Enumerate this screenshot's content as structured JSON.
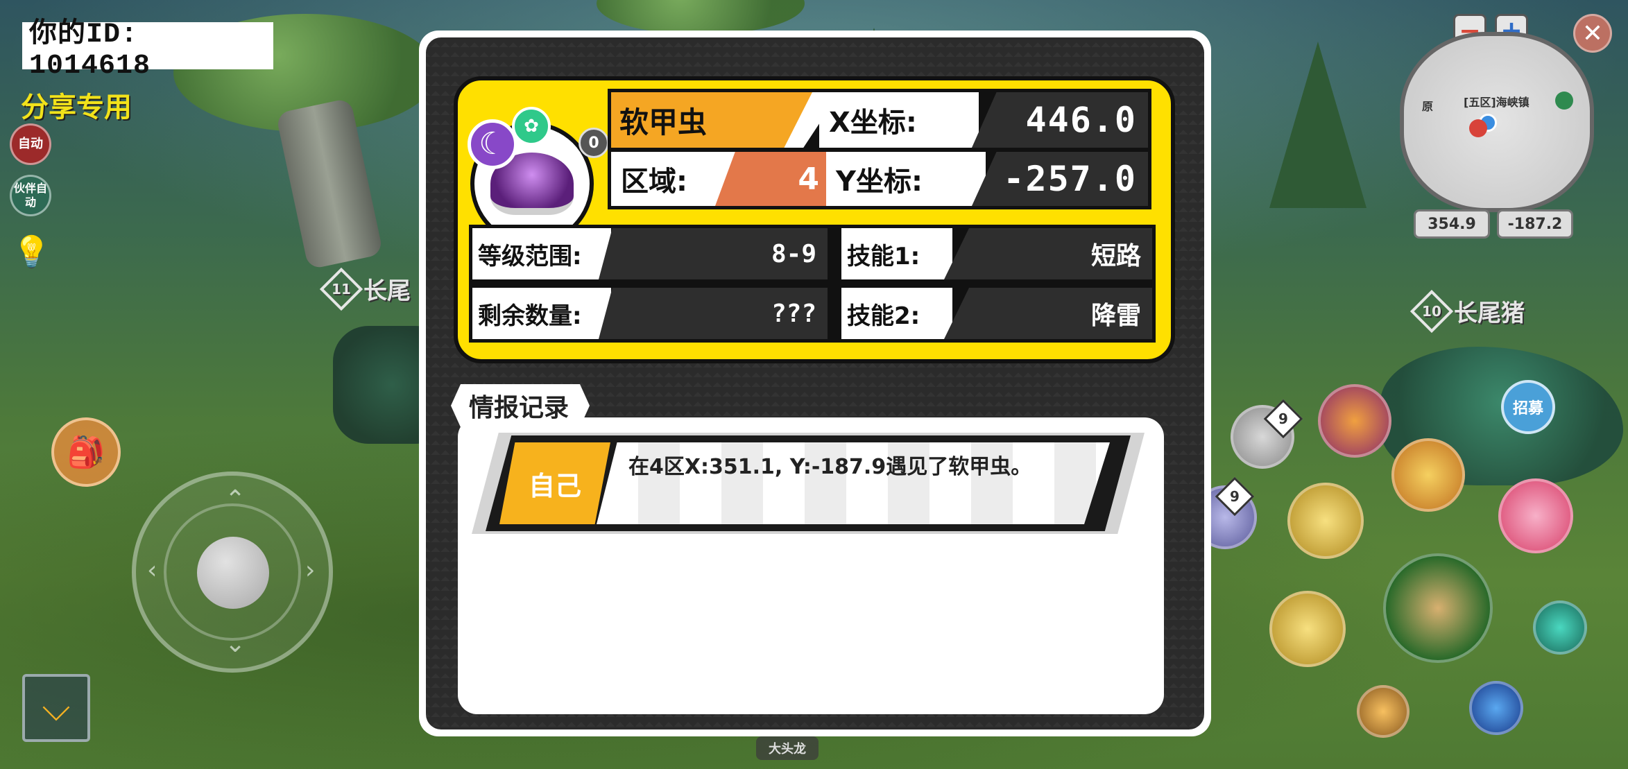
{
  "hud": {
    "id_label": "你的ID: 1014618",
    "share_label": "分享专用",
    "auto_label": "自动",
    "partner_auto_label": "伙伴自动",
    "bottom_label": "大头龙"
  },
  "minimap": {
    "zoom_out": "−",
    "zoom_in": "+",
    "close": "✕",
    "location_label": "[五区]海峡镇",
    "side_label": "原",
    "coord_x": "354.9",
    "coord_y": "-187.2"
  },
  "world_labels": {
    "left_level": "11",
    "left_name": "长尾",
    "right_level": "10",
    "right_name": "长尾猪",
    "recruit": "招募"
  },
  "skill_badges": {
    "potion_count": "9",
    "item_count": "9"
  },
  "panel": {
    "creature_name": "软甲虫",
    "x_label": "X坐标:",
    "x_value": "446.0",
    "y_label": "Y坐标:",
    "y_value": "-257.0",
    "region_label": "区域:",
    "region_value": "4",
    "level_range_label": "等级范围:",
    "level_range_value": "8-9",
    "remaining_label": "剩余数量:",
    "remaining_value": "???",
    "skill1_label": "技能1:",
    "skill1_value": "短路",
    "skill2_label": "技能2:",
    "skill2_value": "降雷",
    "tag_icon": "0",
    "records_title": "情报记录",
    "records": [
      {
        "who": "自己",
        "text": "在4区X:351.1, Y:-187.9遇见了软甲虫。"
      }
    ]
  }
}
